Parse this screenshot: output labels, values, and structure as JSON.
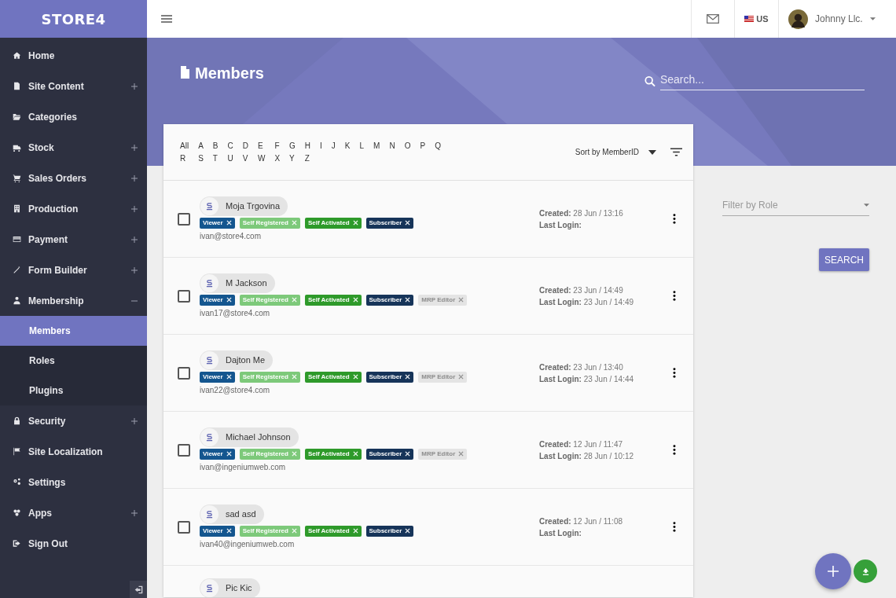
{
  "brand": {
    "logo": "STORE4"
  },
  "sidebar": {
    "items": [
      {
        "label": "Home"
      },
      {
        "label": "Site Content",
        "expanded": false
      },
      {
        "label": "Categories"
      },
      {
        "label": "Stock",
        "expanded": false
      },
      {
        "label": "Sales Orders",
        "expanded": false
      },
      {
        "label": "Production",
        "expanded": false
      },
      {
        "label": "Payment",
        "expanded": false
      },
      {
        "label": "Form Builder",
        "expanded": false
      },
      {
        "label": "Membership",
        "expanded": true,
        "children": [
          {
            "label": "Members",
            "selected": true
          },
          {
            "label": "Roles",
            "selected": false
          },
          {
            "label": "Plugins",
            "selected": false
          }
        ]
      },
      {
        "label": "Security",
        "expanded": false
      },
      {
        "label": "Site Localization"
      },
      {
        "label": "Settings"
      },
      {
        "label": "Apps",
        "expanded": false
      },
      {
        "label": "Sign Out"
      }
    ]
  },
  "header": {
    "language": "US",
    "user": "Johnny Llc."
  },
  "page": {
    "title": "Members",
    "search": {
      "placeholder": "Search..."
    }
  },
  "alphabet": {
    "letters": [
      "All",
      "A",
      "B",
      "C",
      "D",
      "E",
      "F",
      "G",
      "H",
      "I",
      "J",
      "K",
      "L",
      "M",
      "N",
      "O",
      "P",
      "Q",
      "R",
      "S",
      "T",
      "U",
      "V",
      "W",
      "X",
      "Y",
      "Z"
    ]
  },
  "sort": {
    "label": "Sort by MemberID"
  },
  "members": [
    {
      "name": "Moja Trgovina",
      "checked": false,
      "email": "ivan@store4.com",
      "created_label": "Created:",
      "created": "28 Jun / 13:16",
      "login_label": "Last Login:",
      "tags": [
        {
          "label": "Viewer",
          "color": "#14568f"
        },
        {
          "label": "Self Registered",
          "color": "#7dc97a"
        },
        {
          "label": "Self Activated",
          "color": "#2e9a2a"
        },
        {
          "label": "Subscriber",
          "color": "#163459"
        }
      ]
    },
    {
      "name": "M Jackson",
      "checked": false,
      "email": "ivan17@store4.com",
      "created_label": "Created:",
      "created": "23 Jun / 14:49",
      "login_label": "Last Login:",
      "login": "23 Jun / 14:49",
      "tags": [
        {
          "label": "Viewer",
          "color": "#14568f"
        },
        {
          "label": "Self Registered",
          "color": "#7dc97a"
        },
        {
          "label": "Self Activated",
          "color": "#2e9a2a"
        },
        {
          "label": "Subscriber",
          "color": "#163459"
        },
        {
          "label": "MRP Editor",
          "color": "#e4e4e4"
        }
      ]
    },
    {
      "name": "Dajton Me",
      "checked": false,
      "email": "ivan22@store4.com",
      "created_label": "Created:",
      "created": "23 Jun / 13:40",
      "login_label": "Last Login:",
      "login": "23 Jun / 14:44",
      "tags": [
        {
          "label": "Viewer",
          "color": "#14568f"
        },
        {
          "label": "Self Registered",
          "color": "#7dc97a"
        },
        {
          "label": "Self Activated",
          "color": "#2e9a2a"
        },
        {
          "label": "Subscriber",
          "color": "#163459"
        },
        {
          "label": "MRP Editor",
          "color": "#e4e4e4"
        }
      ]
    },
    {
      "name": "Michael Johnson",
      "checked": false,
      "email": "ivan@ingeniumweb.com",
      "created_label": "Created:",
      "created": "12 Jun / 11:47",
      "login_label": "Last Login:",
      "login": "28 Jun / 10:12",
      "tags": [
        {
          "label": "Viewer",
          "color": "#14568f"
        },
        {
          "label": "Self Registered",
          "color": "#7dc97a"
        },
        {
          "label": "Self Activated",
          "color": "#2e9a2a"
        },
        {
          "label": "Subscriber",
          "color": "#163459"
        },
        {
          "label": "MRP Editor",
          "color": "#e4e4e4"
        }
      ]
    },
    {
      "name": "sad asd",
      "checked": false,
      "email": "ivan40@ingeniumweb.com",
      "created_label": "Created:",
      "created": "12 Jun / 11:08",
      "login_label": "Last Login:",
      "tags": [
        {
          "label": "Viewer",
          "color": "#14568f"
        },
        {
          "label": "Self Registered",
          "color": "#7dc97a"
        },
        {
          "label": "Self Activated",
          "color": "#2e9a2a"
        },
        {
          "label": "Subscriber",
          "color": "#163459"
        }
      ]
    },
    {
      "name": "Pic Kic"
    }
  ],
  "filter": {
    "placeholder": "Filter by Role",
    "button": "SEARCH"
  }
}
